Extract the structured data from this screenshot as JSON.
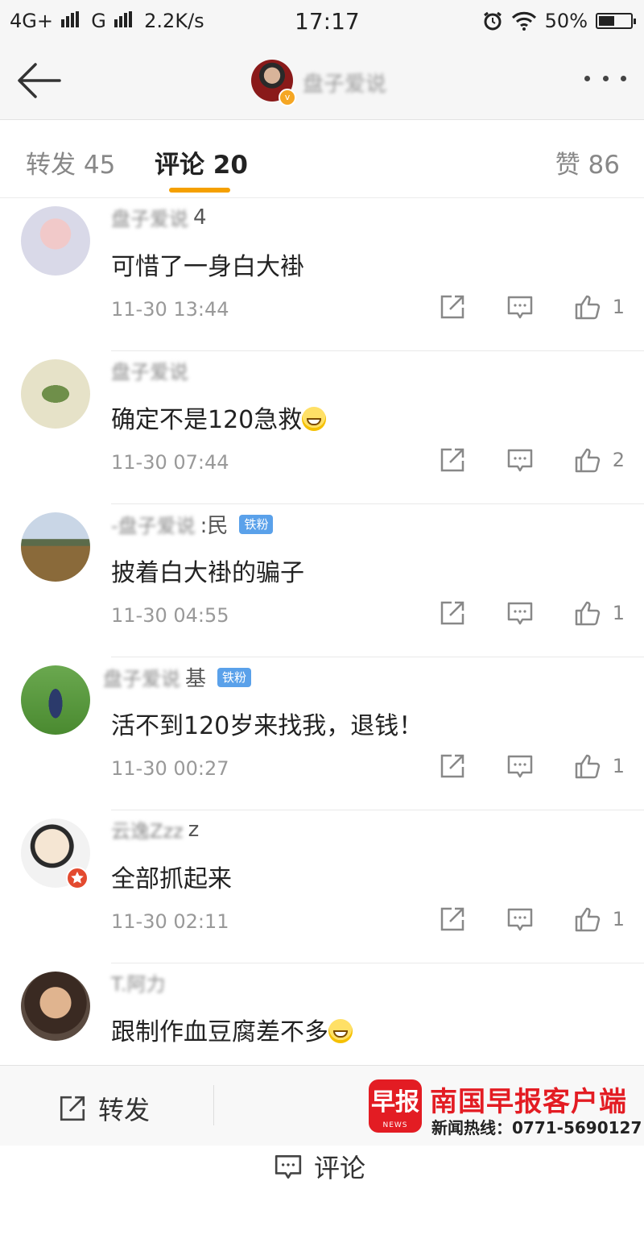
{
  "status_bar": {
    "network_left": "4G+",
    "network_mid": "G",
    "speed": "2.2K/s",
    "time": "17:17",
    "battery": "50%",
    "battery_level": 0.5
  },
  "header": {
    "username": "盘子爱说",
    "verified_badge": "v"
  },
  "tabs": {
    "repost": "转发 45",
    "comment": "评论 20",
    "like": "赞 86"
  },
  "comments": [
    {
      "user": "盘子爱说",
      "suffix": "4",
      "badge": "",
      "text": "可惜了一身白大褂",
      "emoji": false,
      "time": "11-30 13:44",
      "likes": "1"
    },
    {
      "user": "盘子爱说",
      "suffix": "",
      "badge": "",
      "text": "确定不是120急救",
      "emoji": true,
      "time": "11-30 07:44",
      "likes": "2"
    },
    {
      "user": "-盘子爱说",
      "suffix": ":民",
      "badge": "铁粉",
      "text": "披着白大褂的骗子",
      "emoji": false,
      "time": "11-30 04:55",
      "likes": "1"
    },
    {
      "user": "盘子爱说",
      "suffix": "基",
      "badge": "铁粉",
      "text": "活不到120岁来找我，退钱！",
      "emoji": false,
      "time": "11-30 00:27",
      "likes": "1"
    },
    {
      "user": "云逸Zzz",
      "suffix": "z",
      "badge": "",
      "text": "全部抓起来",
      "emoji": false,
      "time": "11-30 02:11",
      "likes": "1"
    },
    {
      "user": "T.阿力",
      "suffix": "",
      "badge": "",
      "text": "跟制作血豆腐差不多",
      "emoji": true,
      "time": "",
      "likes": ""
    }
  ],
  "bottom_bar": {
    "repost": "转发",
    "comment": "评论"
  },
  "watermark": {
    "logo": "早报",
    "logo_sub": "NEWS",
    "title": "南国早报客户端",
    "hotline": "新闻热线：0771-5690127"
  },
  "colors": {
    "accent_underline": "#f5a000",
    "badge_blue": "#5aa1ea",
    "watermark_red": "#e31c23"
  }
}
